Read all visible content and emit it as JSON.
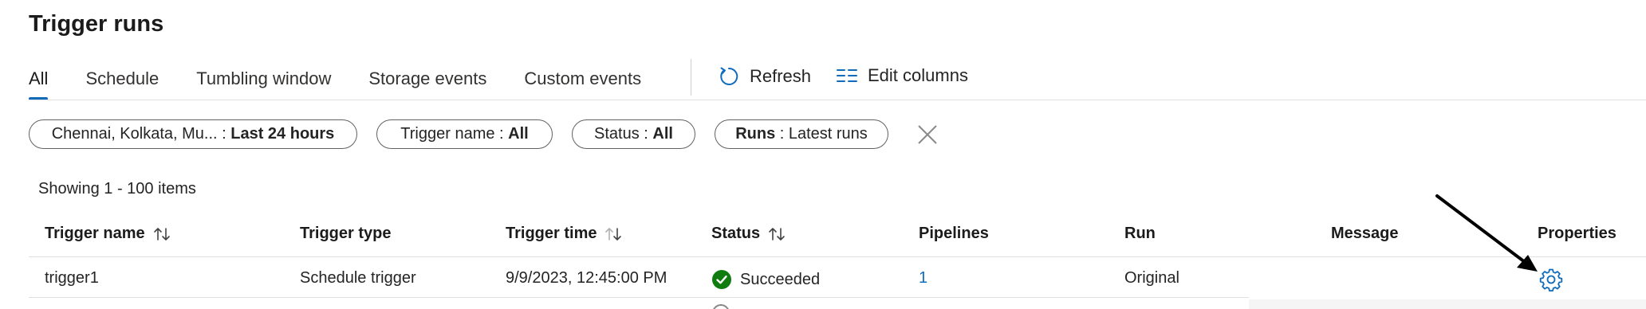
{
  "page": {
    "title": "Trigger runs"
  },
  "tabs": [
    {
      "label": "All",
      "active": true
    },
    {
      "label": "Schedule",
      "active": false
    },
    {
      "label": "Tumbling window",
      "active": false
    },
    {
      "label": "Storage events",
      "active": false
    },
    {
      "label": "Custom events",
      "active": false
    }
  ],
  "toolbar": {
    "refresh_label": "Refresh",
    "refresh_icon": "refresh-icon",
    "edit_columns_label": "Edit columns",
    "edit_columns_icon": "columns-icon"
  },
  "filters": {
    "time": {
      "value": "Chennai, Kolkata, Mu...",
      "sep": " : ",
      "selection": "Last 24 hours"
    },
    "trigger_name": {
      "label": "Trigger name",
      "sep": " : ",
      "selection": "All"
    },
    "status": {
      "label": "Status",
      "sep": " : ",
      "selection": "All"
    },
    "runs": {
      "label": "Runs",
      "sep": " : ",
      "selection": "Latest runs"
    },
    "clear_icon": "close-icon"
  },
  "results": {
    "count_text": "Showing 1 - 100 items"
  },
  "table": {
    "columns": [
      {
        "label": "Trigger name",
        "sortable": true
      },
      {
        "label": "Trigger type",
        "sortable": false
      },
      {
        "label": "Trigger time",
        "sortable": true
      },
      {
        "label": "Status",
        "sortable": true
      },
      {
        "label": "Pipelines",
        "sortable": false
      },
      {
        "label": "Run",
        "sortable": false
      },
      {
        "label": "Message",
        "sortable": false
      },
      {
        "label": "Properties",
        "sortable": false
      }
    ],
    "rows": [
      {
        "trigger_name": "trigger1",
        "trigger_type": "Schedule trigger",
        "trigger_time": "9/9/2023, 12:45:00 PM",
        "status": "Succeeded",
        "status_icon": "check-circle-icon",
        "pipelines": "1",
        "run": "Original",
        "message": "",
        "properties_icon": "gear-icon"
      }
    ]
  },
  "colors": {
    "accent": "#0f6cbd",
    "success": "#107c10",
    "text": "#242424",
    "border": "#616161"
  }
}
